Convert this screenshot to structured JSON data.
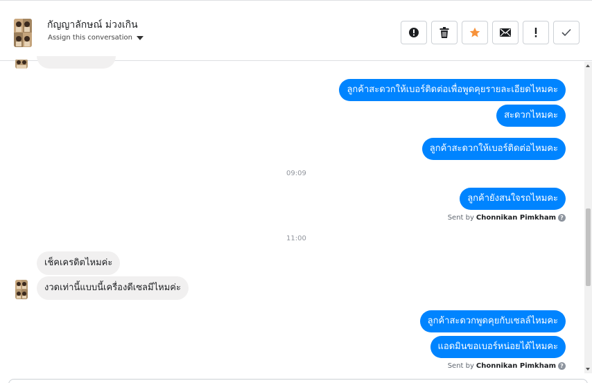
{
  "header": {
    "contact_name": "กัญญาลักษณ์ ม่วงเกิน",
    "assign_label": "Assign this conversation",
    "buttons": [
      {
        "name": "spam-button",
        "icon": "alert-circle-icon"
      },
      {
        "name": "delete-button",
        "icon": "trash-icon"
      },
      {
        "name": "star-button",
        "icon": "star-icon"
      },
      {
        "name": "mark-unread-button",
        "icon": "envelope-icon"
      },
      {
        "name": "follow-up-button",
        "icon": "exclamation-icon"
      },
      {
        "name": "mark-done-button",
        "icon": "check-icon"
      }
    ]
  },
  "messages": {
    "out1": "ลูกค้าสะดวกให้เบอร์ติดต่อเพื่อพูดคุยรายละเอียดไหมคะ",
    "out2": "สะดวกไหมคะ",
    "out3": "ลูกค้าสะดวกให้เบอร์ติดต่อไหมคะ",
    "time1": "09:09",
    "out4": "ลูกค้ายังสนใจรถไหมคะ",
    "sent_by_prefix": "Sent by",
    "sent_by_name": "Chonnikan Pimkham",
    "time2": "11:00",
    "in1": "เช็คเครดิตไหมค่ะ",
    "in2": "งวดเท่านี้แบบนี้เครื่องดีเซลมีไหมค่ะ",
    "out5": "ลูกค้าสะดวกพูดคุยกับเซลล์ไหมคะ",
    "out6": "แอดมินขอเบอร์หน่อยได้ไหมคะ"
  },
  "colors": {
    "outgoing_bubble": "#0084ff",
    "incoming_bubble": "#f1f0f0",
    "star_accent": "#f7923a"
  }
}
